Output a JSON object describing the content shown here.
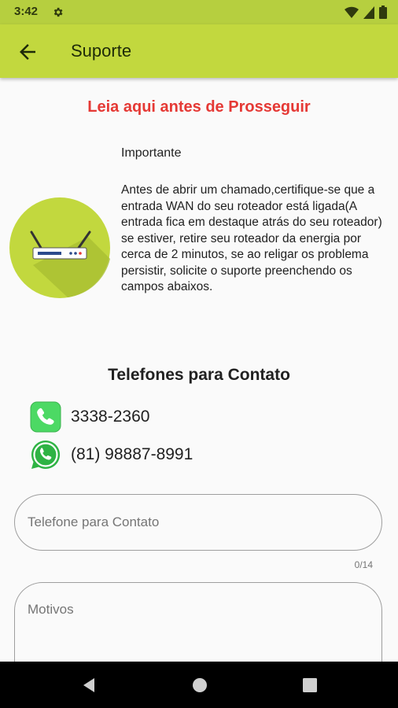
{
  "status_bar": {
    "time": "3:42"
  },
  "app_bar": {
    "title": "Suporte"
  },
  "warning": {
    "title": "Leia aqui antes de Prosseguir"
  },
  "info": {
    "label": "Importante",
    "body": "Antes de abrir um chamado,certifique-se que a entrada WAN do seu roteador está ligada(A entrada fica em destaque atrás do seu roteador) se estiver, retire seu roteador da energia por cerca de 2 minutos, se ao religar os problema persistir, solicite o suporte preenchendo os campos abaixos."
  },
  "contacts": {
    "title": "Telefones para Contato",
    "items": [
      {
        "icon": "phone-icon",
        "number": "3338-2360"
      },
      {
        "icon": "whatsapp-icon",
        "number": "(81) 98887-8991"
      }
    ]
  },
  "form": {
    "phone_placeholder": "Telefone para Contato",
    "phone_counter": "0/14",
    "reason_placeholder": "Motivos"
  },
  "colors": {
    "status_bar": "#b6cf3f",
    "app_bar": "#c2d83e",
    "warning": "#e53935",
    "illustration_bg": "#c2d83e"
  }
}
